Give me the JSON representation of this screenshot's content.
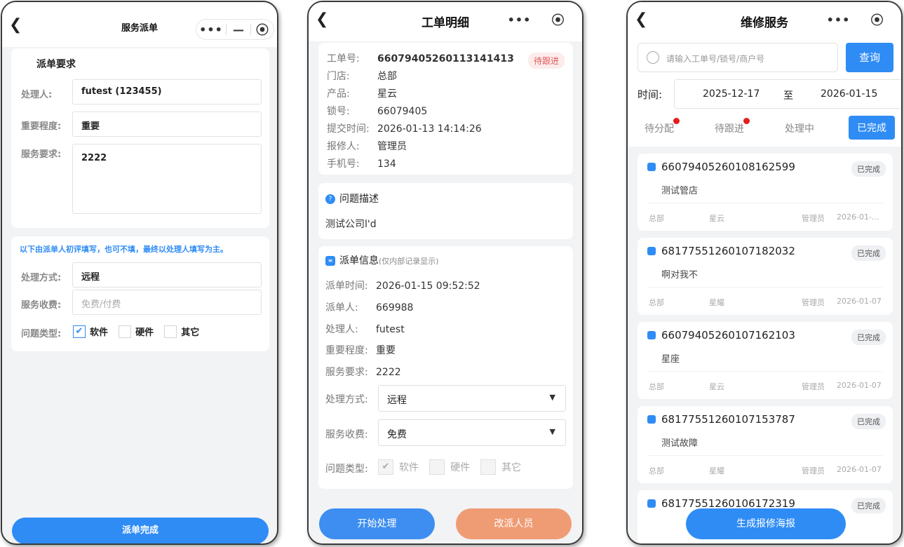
{
  "p1": {
    "title": "服务派单",
    "section_title": "派单要求",
    "handler_label": "处理人:",
    "handler_value": "futest (123455)",
    "importance_label": "重要程度:",
    "importance_value": "重要",
    "req_label": "服务要求:",
    "req_value": "2222",
    "note": "以下由派单人初评填写，也可不填，最终以处理人填写为主。",
    "method_label": "处理方式:",
    "method_value": "远程",
    "fee_label": "服务收费:",
    "fee_placeholder": "免费/付费",
    "type_label": "问题类型:",
    "types": [
      "软件",
      "硬件",
      "其它"
    ],
    "submit": "派单完成"
  },
  "p2": {
    "title": "工单明细",
    "status": "待跟进",
    "rows": [
      {
        "k": "工单号:",
        "v": "66079405260113141413"
      },
      {
        "k": "门店:",
        "v": "总部"
      },
      {
        "k": "产品:",
        "v": "星云"
      },
      {
        "k": "锁号:",
        "v": "66079405"
      },
      {
        "k": "提交时间:",
        "v": "2026-01-13 14:14:26"
      },
      {
        "k": "报修人:",
        "v": "管理员"
      },
      {
        "k": "手机号:",
        "v": "134"
      }
    ],
    "problem_title": "问题描述",
    "problem_text": "测试公司l'd",
    "dispatch_title": "派单信息",
    "dispatch_sub": "(仅内部记录显示)",
    "dispatch_rows": [
      {
        "k": "派单时间:",
        "v": "2026-01-15 09:52:52"
      },
      {
        "k": "派单人:",
        "v": "669988"
      },
      {
        "k": "处理人:",
        "v": "futest"
      },
      {
        "k": "重要程度:",
        "v": "重要"
      },
      {
        "k": "服务要求:",
        "v": "2222"
      }
    ],
    "method_label": "处理方式:",
    "method_value": "远程",
    "fee_label": "服务收费:",
    "fee_value": "免费",
    "type_label": "问题类型:",
    "types": [
      "软件",
      "硬件",
      "其它"
    ],
    "btn_start": "开始处理",
    "btn_reassign": "改派人员"
  },
  "p3": {
    "title": "维修服务",
    "search_placeholder": "请输入工单号/锁号/商户号",
    "search_btn": "查询",
    "time_label": "时间:",
    "date_from": "2025-12-17",
    "date_sep": "至",
    "date_to": "2026-01-15",
    "tabs": [
      "待分配",
      "待跟进",
      "处理中",
      "已完成"
    ],
    "orders": [
      {
        "no": "66079405260108162599",
        "status": "已完成",
        "desc": "测试管店",
        "store": "总部",
        "product": "星云",
        "user": "管理员",
        "date": "2026-01-..."
      },
      {
        "no": "68177551260107182032",
        "status": "已完成",
        "desc": "啊对我不",
        "store": "总部",
        "product": "星耀",
        "user": "管理员",
        "date": "2026-01-07"
      },
      {
        "no": "66079405260107162103",
        "status": "已完成",
        "desc": "星座",
        "store": "总部",
        "product": "星云",
        "user": "管理员",
        "date": "2026-01-07"
      },
      {
        "no": "68177551260107153787",
        "status": "已完成",
        "desc": "测试故障",
        "store": "总部",
        "product": "星耀",
        "user": "管理员",
        "date": "2026-01-07"
      },
      {
        "no": "68177551260106172319",
        "status": "已完成"
      }
    ],
    "poster_btn": "生成报修海报"
  }
}
